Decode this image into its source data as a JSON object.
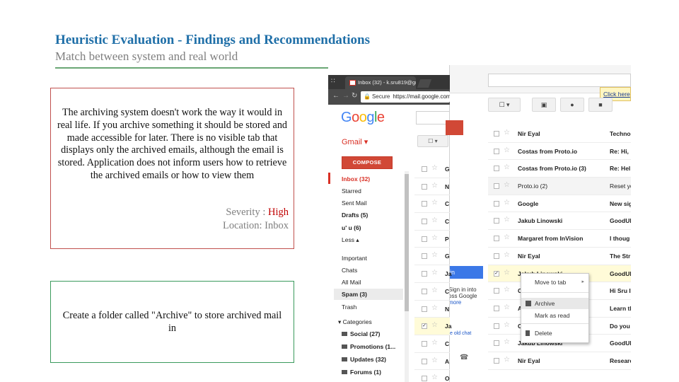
{
  "slide": {
    "title": "Heuristic Evaluation - Findings and Recommendations",
    "subtitle": "Match between system and real world",
    "accent_color": "#1f6fa8",
    "rule_color": "#6aa775"
  },
  "finding": {
    "text": "The archiving system doesn't work the way it would in real life.  If you archive something it should be stored and made accessible for later. There is no visible  tab that displays only the archived emails, although the email is stored. Application does  not inform users how to retrieve the archived emails or how to view them",
    "severity_label": "Severity : ",
    "severity_value": "High",
    "location": "Location: Inbox",
    "border_color": "#c0504d"
  },
  "recommendation": {
    "text": "Create a folder called \"Archive\" to store archived mail in",
    "border_color": "#3a9a5c"
  },
  "screenshot": {
    "browser": {
      "incognito_glyph": "∷",
      "tab_title": "Inbox (32) - k.sru819@gm",
      "omnibox_secure": "Secure",
      "omnibox_url": "https://mail.google.com",
      "back_glyph": "←",
      "forward_glyph": "→",
      "reload_glyph": "↻"
    },
    "logo_letters": [
      {
        "ch": "G",
        "color": "#4285f4"
      },
      {
        "ch": "o",
        "color": "#ea4335"
      },
      {
        "ch": "o",
        "color": "#fbbc05"
      },
      {
        "ch": "g",
        "color": "#4285f4"
      },
      {
        "ch": "l",
        "color": "#34a853"
      },
      {
        "ch": "e",
        "color": "#ea4335"
      }
    ],
    "gmail_label": "Gmail ▾",
    "compose_label": "COMPOSE",
    "select_menu": "☐ ▾",
    "nav": {
      "inbox": "Inbox (32)",
      "starred": "Starred",
      "sent": "Sent Mail",
      "drafts": "Drafts (5)",
      "uu": "u' u   (6)",
      "less": "Less ▴",
      "important": "Important",
      "chats": "Chats",
      "all_mail": "All Mail",
      "spam": "Spam (3)",
      "trash": "Trash",
      "categories": "▾ Categories",
      "social": "Social (27)",
      "promotions": "Promotions (1...",
      "updates": "Updates (32)",
      "forums": "Forums (1)"
    },
    "front_rows": [
      {
        "letter": "G",
        "checked": false
      },
      {
        "letter": "N",
        "checked": false
      },
      {
        "letter": "C",
        "checked": false
      },
      {
        "letter": "C",
        "checked": false
      },
      {
        "letter": "P",
        "checked": false
      },
      {
        "letter": "G",
        "checked": false
      },
      {
        "letter": "Ja",
        "checked": false
      },
      {
        "letter": "C",
        "checked": false
      },
      {
        "letter": "N",
        "checked": false
      },
      {
        "letter": "Ja",
        "checked": true
      },
      {
        "letter": "C",
        "checked": false
      },
      {
        "letter": "A",
        "checked": false
      },
      {
        "letter": "O",
        "checked": false
      }
    ],
    "chat": {
      "signin": "in",
      "desc": "Sign in into oss Google",
      "more": "more",
      "old_chat": "e old chat",
      "phone_glyph": "☎"
    },
    "click_here": "Click here",
    "toolbar": {
      "select": "☐ ▾",
      "archive": "▣",
      "spam": "●",
      "delete": "■"
    },
    "back_rows": [
      {
        "sender": "Nir Eyal",
        "subject": "Techno",
        "read": false,
        "checked": false
      },
      {
        "sender": "Costas from Proto.io",
        "subject": "Re: Hi,",
        "read": false,
        "checked": false
      },
      {
        "sender": "Costas from Proto.io (3)",
        "subject": "Re: Hel",
        "read": false,
        "checked": false
      },
      {
        "sender": "Proto.io (2)",
        "subject": "Reset yo",
        "read": true,
        "checked": false
      },
      {
        "sender": "Google",
        "subject": "New sig",
        "read": false,
        "checked": false
      },
      {
        "sender": "Jakub Linowski",
        "subject": "GoodUI",
        "read": false,
        "checked": false
      },
      {
        "sender": "Margaret from InVision",
        "subject": "I thoug",
        "read": false,
        "checked": false
      },
      {
        "sender": "Nir Eyal",
        "subject": "The Str",
        "read": false,
        "checked": false
      },
      {
        "sender": "Jakub Linowski",
        "subject": "GoodUI",
        "read": false,
        "checked": true
      },
      {
        "sender": "C",
        "subject": "Hi Sru I",
        "read": false,
        "checked": false
      },
      {
        "sender": "A",
        "subject": "Learn th",
        "read": false,
        "checked": false
      },
      {
        "sender": "C",
        "subject": "Do you",
        "read": false,
        "checked": false
      },
      {
        "sender": "Jakub Linowski",
        "subject": "GoodUI",
        "read": false,
        "checked": false
      },
      {
        "sender": "Nir Eyal",
        "subject": "Researc",
        "read": false,
        "checked": false
      }
    ],
    "context_menu": {
      "move_to_tab": "Move to tab",
      "archive": "Archive",
      "mark_as_read": "Mark as read",
      "delete": "Delete",
      "submenu_arrow": "▸"
    },
    "glyphs": {
      "star": "☆",
      "check": "✓"
    }
  }
}
